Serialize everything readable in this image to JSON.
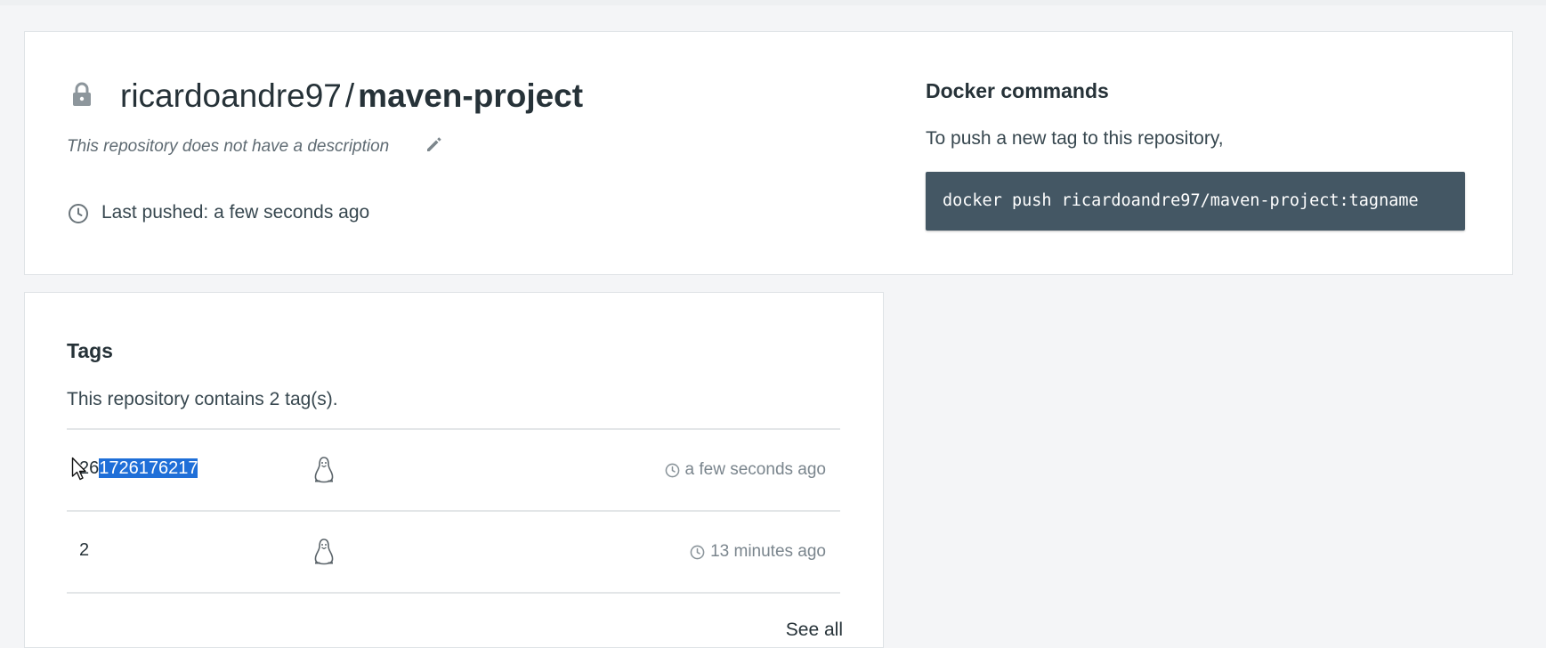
{
  "repository": {
    "owner": "ricardoandre97",
    "separator": "/",
    "name": "maven-project",
    "description": "This repository does not have a description",
    "last_pushed": "Last pushed: a few seconds ago"
  },
  "docker_commands": {
    "heading": "Docker commands",
    "hint": "To push a new tag to this repository,",
    "command": "docker push ricardoandre97/maven-project:tagname"
  },
  "tags": {
    "heading": "Tags",
    "summary": "This repository contains 2 tag(s).",
    "rows": [
      {
        "name_prefix": "26",
        "name_selected": "1726176217",
        "os_icon": "linux-icon",
        "time": "a few seconds ago"
      },
      {
        "name_prefix": "2",
        "name_selected": "",
        "os_icon": "linux-icon",
        "time": "13 minutes ago"
      }
    ],
    "see_all": "See all"
  },
  "colors": {
    "command_bg": "#445764",
    "selection": "#1f6fd8",
    "page_bg": "#f4f5f7"
  },
  "icons": [
    "lock-icon",
    "edit-icon",
    "clock-icon",
    "linux-icon",
    "mouse-cursor-icon"
  ]
}
